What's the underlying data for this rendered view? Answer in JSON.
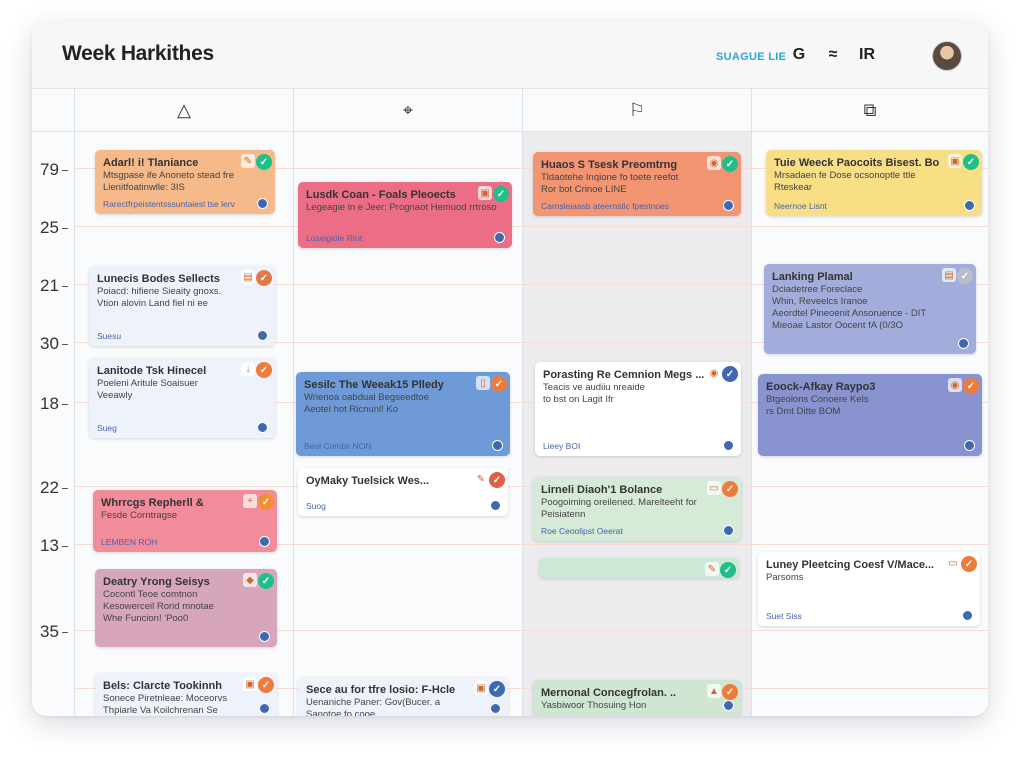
{
  "header": {
    "title": "Week Harkithes",
    "link": "SUAGUE LIE",
    "icons": [
      {
        "name": "refresh-icon",
        "glyph": "G"
      },
      {
        "name": "wifi-icon",
        "glyph": "≈"
      },
      {
        "name": "stats-icon",
        "glyph": "IR"
      },
      {
        "name": "apple-icon",
        "glyph": ""
      }
    ]
  },
  "columns": [
    {
      "icon": "triangle-icon",
      "glyph": "△"
    },
    {
      "icon": "move-icon",
      "glyph": "⌖"
    },
    {
      "icon": "flag-icon",
      "glyph": "⚐"
    },
    {
      "icon": "copy-icon",
      "glyph": "⧉"
    }
  ],
  "hours": [
    "79",
    "25",
    "21",
    "30",
    "18",
    "22",
    "13",
    "35"
  ],
  "cards": {
    "c0": [
      {
        "title": "Adarl! i! Tlaniance",
        "sub": [
          "Mtsgpase ife Anoneto stead fre",
          "Lienitfoatinwlle: 3IS"
        ],
        "footer": "Rarectfrpeistentsssuntaiesl tse lerv",
        "bg": "#f5b98a",
        "badge": "#1fbf8a",
        "ico": "✎"
      },
      {
        "title": "Lunecis Bodes Sellects",
        "sub": [
          "Poiacd: hifiene Sieaity gnoxs.",
          "Vtion alovin Land fiel ni ee"
        ],
        "footer": "Suesu",
        "bg": "#eef3fb",
        "badge": "#e27a46",
        "ico": "▤"
      },
      {
        "title": "Lanitode Tsk Hinecel",
        "sub": [
          "Poeleni Aritule Soaisuer",
          "Veeawly"
        ],
        "footer": "Sueg",
        "bg": "#eef3fb",
        "badge": "#f07a3a",
        "ico": "↓"
      },
      {
        "title": "Whrrcgs Repherll &",
        "sub": [
          "Fesde Corntragse"
        ],
        "footer": "LEMBEN ROH",
        "bg": "#f28c9a",
        "badge": "#f09030",
        "ico": "+"
      },
      {
        "title": "Deatry Yrong Seisys",
        "sub": [
          "Cocontl Teoe comtnon",
          "Kesowerceil Rorid mnotae",
          "Whe Funcion! 'Poo0"
        ],
        "footer": "",
        "bg": "#d7a6bc",
        "badge": "#1fbf8a",
        "ico": "◆"
      },
      {
        "title": "Bels: Clarcte Tookinnh",
        "sub": [
          "Sonece Piretnleae: Moceorvs",
          "Thpiarle Va Koilchrenan Se"
        ],
        "footer": "",
        "bg": "#eef3fb",
        "badge": "#f07a3a",
        "ico": "▣"
      }
    ],
    "c1": [
      {
        "title": "Lusdk Coan - Foals Pleoects",
        "sub": [
          "Legeagie in e Jeer: Prognaot Hemuod rrtroso"
        ],
        "footer": "Loseigiole Rtot",
        "bg": "#ec6e86",
        "badge": "#1fbf8a",
        "ico": "▣"
      },
      {
        "title": "Sesilc The Weeak15 Plledy",
        "sub": [
          "Wrienoa oabdual Begseedtoe",
          "Aeotel hot Ricnunl! Ko"
        ],
        "footer": "Beol Combit NON",
        "bg": "#6e9bd8",
        "badge": "#f07a3a",
        "ico": "▯"
      },
      {
        "title": "OyMaky Tuelsick Wes...",
        "sub": [],
        "footer": "Suog",
        "bg": "#ffffff",
        "badge": "#e05f45",
        "ico": "✎"
      },
      {
        "title": "Sece au for tfre losio: F-Hcle",
        "sub": [
          "Uenaniche Paner: Gov(Bucer. a",
          "Sanotoe fo cooe"
        ],
        "footer": "",
        "bg": "#eef3fb",
        "badge": "#3f68b3",
        "ico": "▣"
      }
    ],
    "c2": [
      {
        "title": "Huaos S Tsesk Preomtrng",
        "sub": [
          "Tldaotehe Inqione fo toete reefot",
          "Ror  bot Crinoe LINE"
        ],
        "footer": "Carnsleiaasb ateernstic fpestnoes",
        "bg": "#f39572",
        "badge": "#1fbf8a",
        "ico": "◉"
      },
      {
        "title": "Porasting Re Cemnion Megs ...",
        "sub": [
          "Teacis ve audiiu nreaide",
          "to bst on Lagit Ifr"
        ],
        "footer": "Lieey BOI",
        "bg": "#ffffff",
        "badge": "#3f68b3",
        "ico": "◉"
      },
      {
        "title": "Lirneli Diaoh'1 Bolance",
        "sub": [
          "Poogoiming oreilened. Marelteeht for",
          "Peisiatenn"
        ],
        "footer": "Roe Ceoolipst Oeerat",
        "bg": "#d6ead8",
        "badge": "#f07a3a",
        "ico": "▭"
      },
      {
        "title": "",
        "sub": [],
        "footer": "",
        "bg": "#cde8d4",
        "badge": "#1fbf8a",
        "ico": "✎"
      },
      {
        "title": "Mernonal Concegfrolan. ..",
        "sub": [
          "Yasbiwoor Thosuing Hon"
        ],
        "footer": "",
        "bg": "#cfe6d2",
        "badge": "#f07a3a",
        "ico": "▲"
      }
    ],
    "c3": [
      {
        "title": "Tuie Weeck Paocoits Bisest. Bo",
        "sub": [
          "Mrsadaen fe Dose ocsonoptle ttle",
          "Rteskear"
        ],
        "footer": "Neernoe Lisnt",
        "bg": "#f8de85",
        "badge": "#1fbf8a",
        "ico": "▣"
      },
      {
        "title": "Lanking Plamal",
        "sub": [
          "Dciadetree Foreclace",
          "Whin, Reveelcs Iranoe",
          "Aeordtel Pineoenit Ansoruence - DIT",
          "Mieoae Lastor Oocent fA (0/3O"
        ],
        "footer": "",
        "bg": "#a3addb",
        "badge": "#b8bdc9",
        "ico": "▤"
      },
      {
        "title": "Eoock-Afkay Raypo3",
        "sub": [
          "Btgeolons Conoere Kels",
          "rs Dmt Ditte BOM"
        ],
        "footer": "",
        "bg": "#8893cf",
        "badge": "#f07a3a",
        "ico": "◉"
      },
      {
        "title": "Luney Pleetcing Coesf V/Mace...",
        "sub": [
          "Parsoms"
        ],
        "footer": "Suet Siss",
        "bg": "#ffffff",
        "badge": "#f07a3a",
        "ico": "▭"
      }
    ]
  }
}
